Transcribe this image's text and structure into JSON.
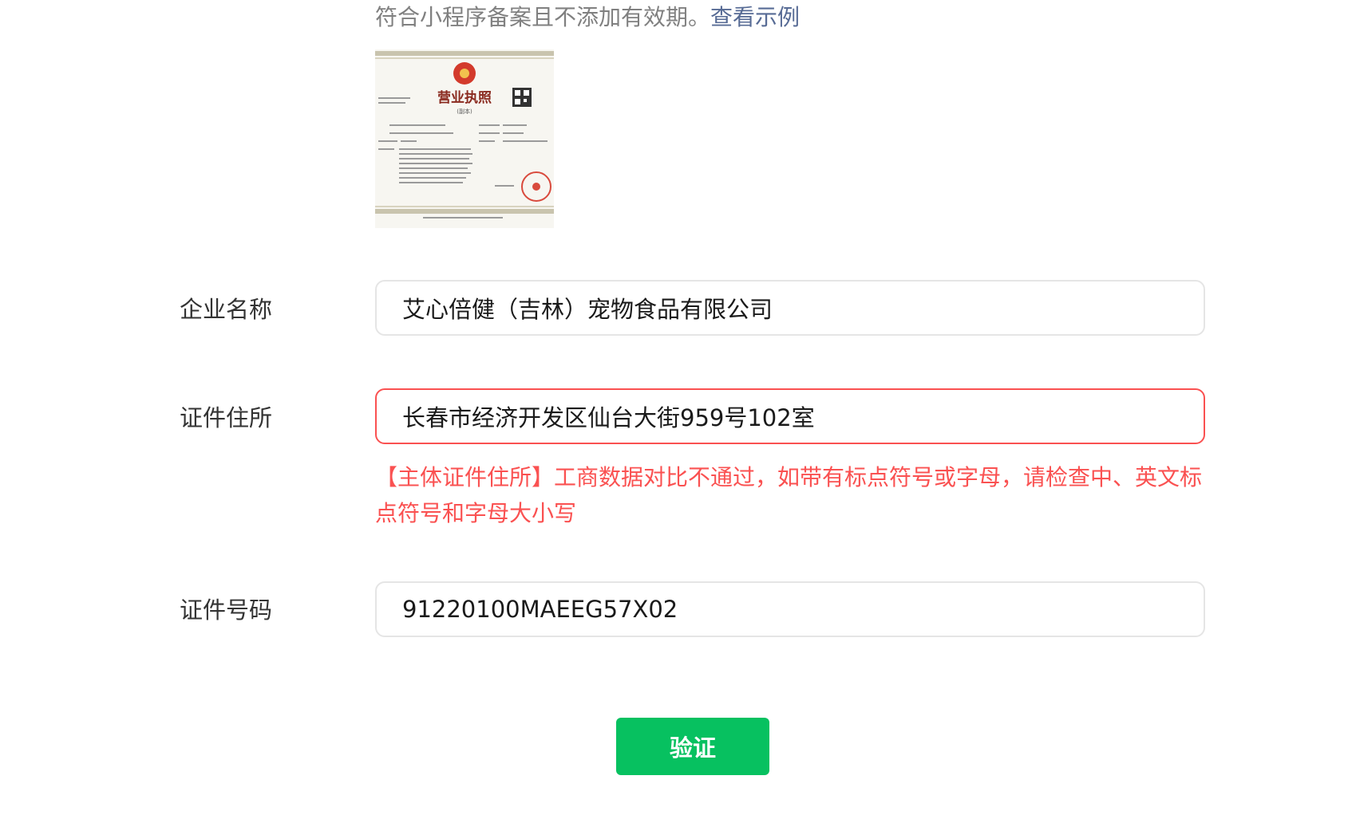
{
  "hint": {
    "text": "符合小程序备案且不添加有效期。",
    "link": "查看示例"
  },
  "license_image": {
    "icon": "business-license-image",
    "title": "营业执照",
    "subtitle": "(副本)"
  },
  "form": {
    "company_name": {
      "label": "企业名称",
      "value": "艾心倍健（吉林）宠物食品有限公司"
    },
    "address": {
      "label": "证件住所",
      "value": "长春市经济开发区仙台大街959号102室",
      "error": "【主体证件住所】工商数据对比不通过，如带有标点符号或字母，请检查中、英文标点符号和字母大小写"
    },
    "license_number": {
      "label": "证件号码",
      "value": "91220100MAEEG57X02"
    }
  },
  "verify_button": {
    "label": "验证"
  },
  "colors": {
    "accent": "#07c160",
    "error": "#fa5151",
    "link": "#576b95"
  }
}
